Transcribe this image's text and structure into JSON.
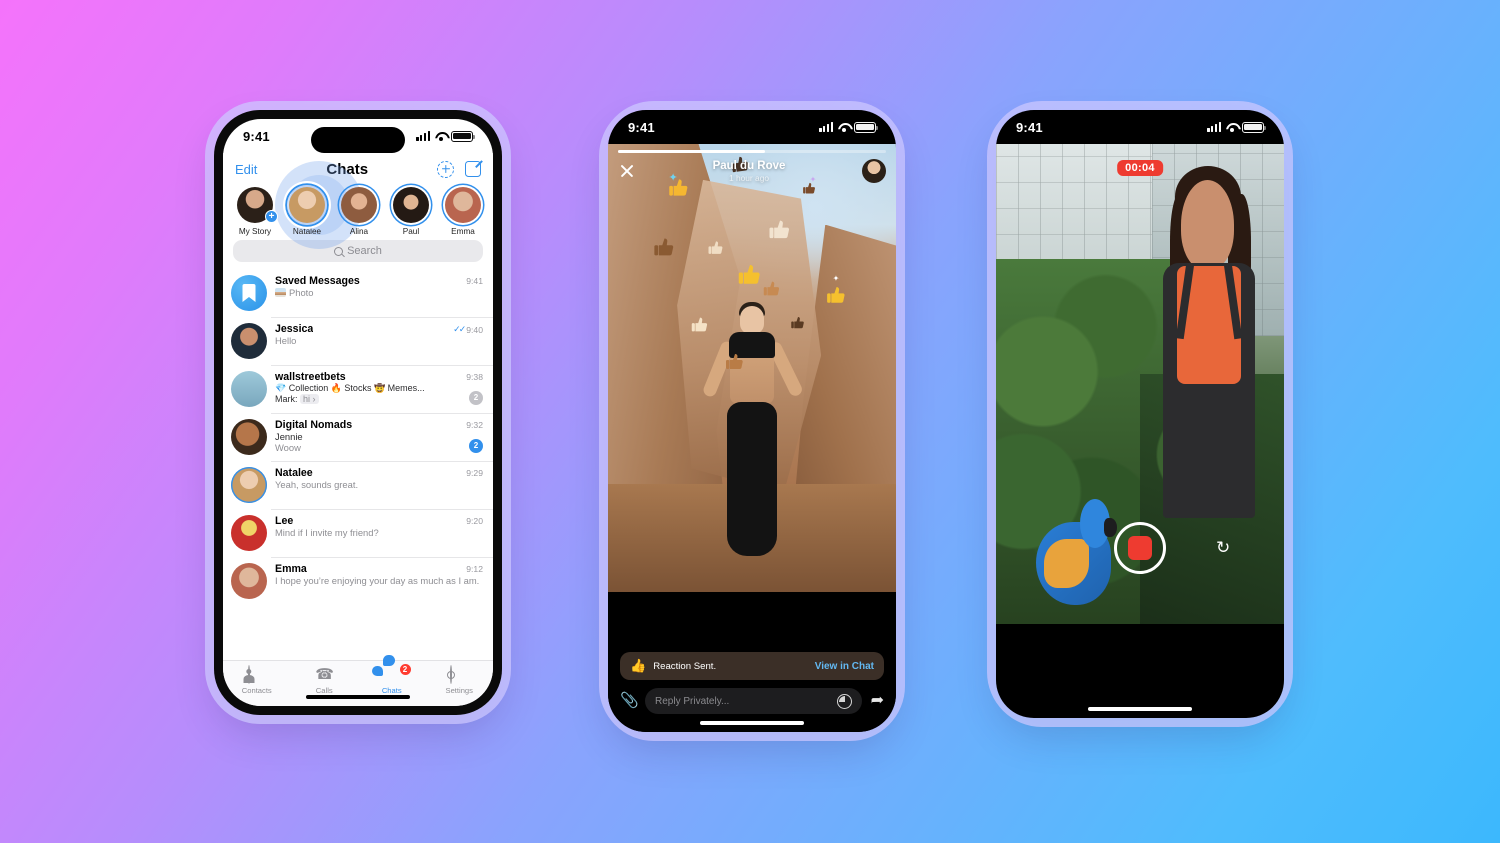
{
  "background": {
    "from": "#f573fb",
    "to": "#3cb8fd"
  },
  "accent": {
    "blue": "#3290ec",
    "red": "#ee3b30",
    "link": "#63b9f2"
  },
  "phone1": {
    "status": {
      "time": "9:41",
      "signal_icon": "signal-bars-icon",
      "wifi_icon": "wifi-icon",
      "battery_icon": "battery-icon"
    },
    "nav": {
      "edit_label": "Edit",
      "title": "Chats",
      "add_story_icon": "add-story-icon",
      "compose_icon": "compose-icon"
    },
    "stories": [
      {
        "name": "My Story",
        "state": "own",
        "plus": "+"
      },
      {
        "name": "Natalee",
        "state": "selected"
      },
      {
        "name": "Alina",
        "state": "unread"
      },
      {
        "name": "Paul",
        "state": "unread"
      },
      {
        "name": "Emma",
        "state": "unread"
      }
    ],
    "search": {
      "placeholder": "Search",
      "icon": "search-icon"
    },
    "chats": [
      {
        "title": "Saved Messages",
        "time": "9:41",
        "preview": "Photo",
        "icon": "saved-messages-icon",
        "has_photo_thumb": true
      },
      {
        "title": "Jessica",
        "time": "9:40",
        "preview": "Hello",
        "read_receipt": "✓✓"
      },
      {
        "title": "wallstreetbets",
        "time": "9:38",
        "tags": "💎 Collection 🔥 Stocks 🤠 Memes...",
        "sender": "Mark:",
        "chip": "hi ›",
        "badge": "2",
        "badge_color": "gray"
      },
      {
        "title": "Digital Nomads",
        "time": "9:32",
        "sender": "Jennie",
        "preview": "Woow",
        "badge": "2",
        "badge_color": "blue"
      },
      {
        "title": "Natalee",
        "time": "9:29",
        "preview": "Yeah, sounds great."
      },
      {
        "title": "Lee",
        "time": "9:20",
        "preview": "Mind if I invite my friend?"
      },
      {
        "title": "Emma",
        "time": "9:12",
        "preview": "I hope you’re enjoying your day as much as I am."
      }
    ],
    "tabs": [
      {
        "label": "Contacts",
        "icon": "contacts-icon",
        "active": false
      },
      {
        "label": "Calls",
        "icon": "phone-icon",
        "active": false
      },
      {
        "label": "Chats",
        "icon": "chats-icon",
        "active": true,
        "badge": "2"
      },
      {
        "label": "Settings",
        "icon": "gear-icon",
        "active": false
      }
    ]
  },
  "phone2": {
    "status": {
      "time": "9:41"
    },
    "story": {
      "close_icon": "close-icon",
      "author": "Paul du Rove",
      "timestamp": "1 hour ago",
      "progress_percent": 55,
      "avatar_icon": "story-author-avatar"
    },
    "toast": {
      "emoji": "👍",
      "label": "Reaction Sent.",
      "action": "View in Chat"
    },
    "reply": {
      "attach_icon": "paperclip-icon",
      "placeholder": "Reply Privately...",
      "timer_icon": "timer-icon",
      "share_icon": "share-icon"
    }
  },
  "phone3": {
    "status": {
      "time": "9:41"
    },
    "camera": {
      "recording_time": "00:04",
      "record_button_icon": "record-stop-icon",
      "flip_camera_icon": "flip-camera-icon"
    }
  }
}
